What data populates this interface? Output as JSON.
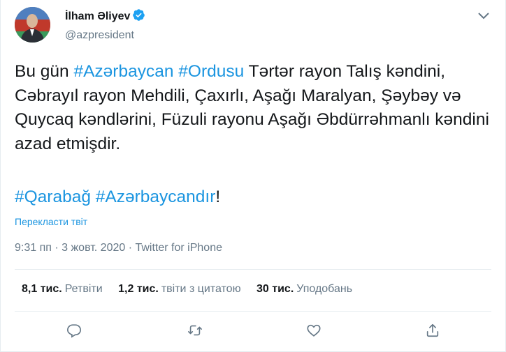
{
  "author": {
    "display_name": "İlham Əliyev",
    "handle": "@azpresident",
    "verified": true
  },
  "tweet": {
    "segments": [
      {
        "text": "Bu gün ",
        "type": "text"
      },
      {
        "text": "#Azərbaycan",
        "type": "hashtag"
      },
      {
        "text": " ",
        "type": "text"
      },
      {
        "text": "#Ordusu",
        "type": "hashtag"
      },
      {
        "text": " Tərtər rayon Talış kəndini, Cəbrayıl rayon Mehdili, Çaxırlı, Aşağı Maralyan, Şəybəy və Quycaq kəndlərini, Füzuli rayonu Aşağı Əbdürrəhmanlı kəndini azad etmişdir.",
        "type": "text"
      }
    ],
    "hashtag_line": {
      "tag1": "#Qarabağ",
      "space": " ",
      "tag2": "#Azərbaycandır",
      "suffix": "!"
    },
    "translate_label": "Перекласти твіт",
    "timestamp": "9:31 пп · 3 жовт. 2020 · Twitter for iPhone"
  },
  "stats": {
    "retweets": {
      "count": "8,1 тис.",
      "label": "Ретвіти"
    },
    "quotes": {
      "count": "1,2 тис.",
      "label": "твіти з цитатою"
    },
    "likes": {
      "count": "30 тис.",
      "label": "Уподобань"
    }
  },
  "actions": {
    "icons": [
      "reply-icon",
      "retweet-icon",
      "like-icon",
      "share-icon"
    ]
  },
  "colors": {
    "link": "#1b95e0",
    "secondary_text": "#657786",
    "primary_text": "#14171a",
    "divider": "#e6ecf0",
    "verified": "#1da1f2"
  }
}
